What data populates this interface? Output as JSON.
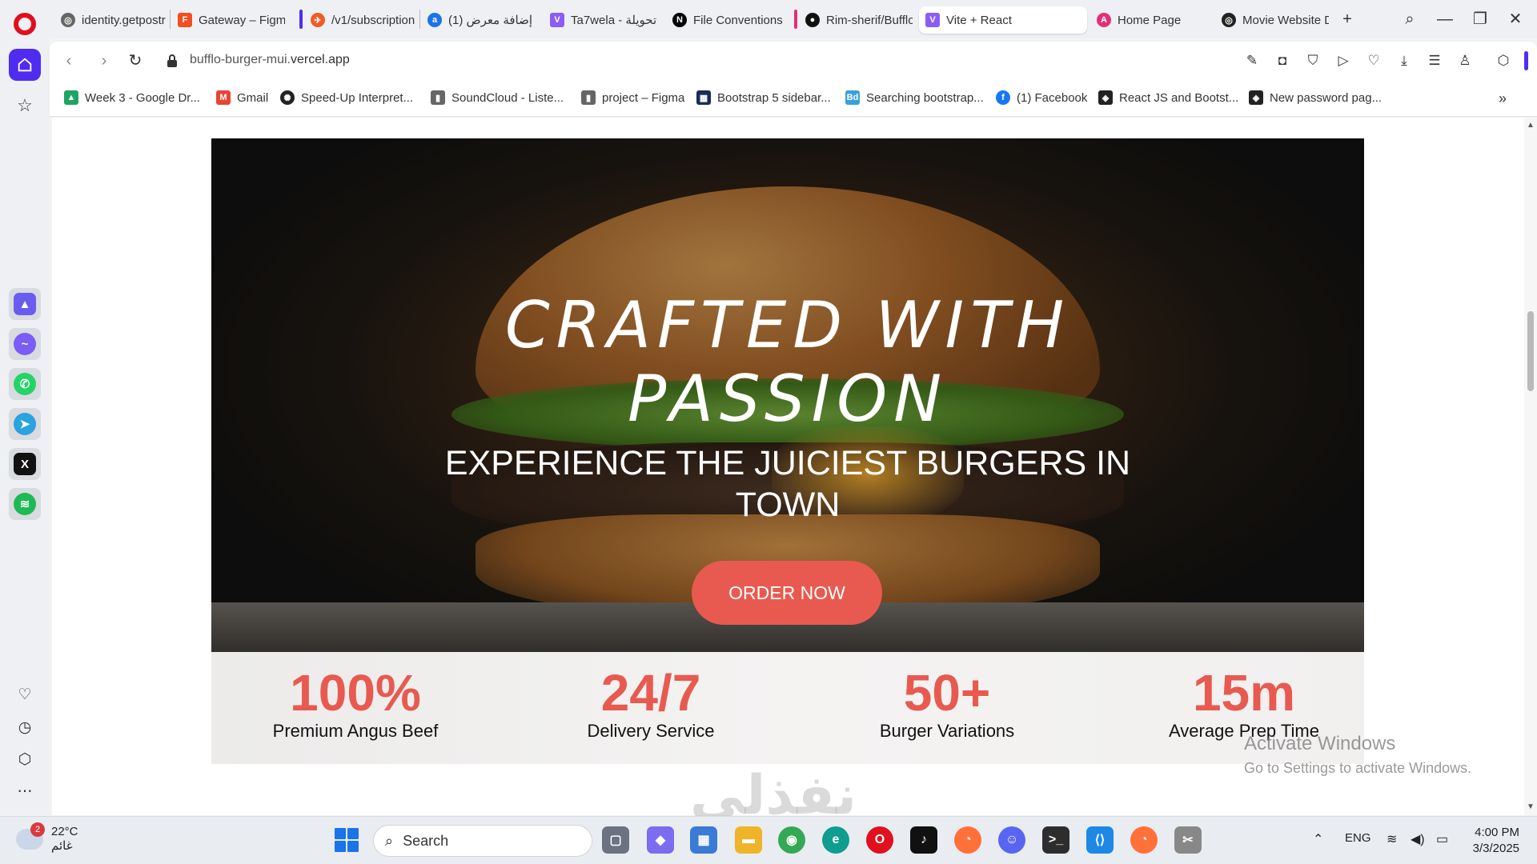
{
  "browser": {
    "tabs": [
      {
        "label": "identity.getpostr",
        "icon": "globe-icon",
        "color": "#555555"
      },
      {
        "label": "Gateway – Figma",
        "icon": "figma-icon",
        "color": "#f24e1e"
      },
      {
        "label": "/v1/subscription",
        "icon": "postman-icon",
        "color": "#ef5b25"
      },
      {
        "label": "(1) إضافة معرض",
        "icon": "site-icon",
        "color": "#1a73e8"
      },
      {
        "label": "Ta7wela - تحويلة",
        "icon": "vite-icon",
        "color": "#8b5cf6"
      },
      {
        "label": "File Conventions",
        "icon": "nextjs-icon",
        "color": "#000000"
      },
      {
        "label": "Rim-sherif/Bufflo",
        "icon": "github-icon",
        "color": "#111111"
      },
      {
        "label": "Vite + React",
        "icon": "vite-icon",
        "color": "#8b5cf6"
      },
      {
        "label": "Home Page",
        "icon": "site-icon",
        "color": "#e0307a"
      },
      {
        "label": "Movie Website D",
        "icon": "site-icon",
        "color": "#222222"
      }
    ],
    "url_host": "bufflo-burger-mui.",
    "url_domain": "vercel.app",
    "bookmarks": [
      {
        "label": "Week 3 - Google Dr...",
        "icon": "drive-icon",
        "color": "#1fa463"
      },
      {
        "label": "Gmail",
        "icon": "gmail-icon",
        "color": "#ea4335"
      },
      {
        "label": "Speed-Up Interpret...",
        "icon": "openai-icon",
        "color": "#222222"
      },
      {
        "label": "SoundCloud - Liste...",
        "icon": "file-icon",
        "color": "#555555"
      },
      {
        "label": "project – Figma",
        "icon": "file-icon",
        "color": "#555555"
      },
      {
        "label": "Bootstrap 5 sidebar...",
        "icon": "site-icon",
        "color": "#1a2a5a"
      },
      {
        "label": "Searching bootstrap...",
        "icon": "bd-icon",
        "color": "#3aa0d8"
      },
      {
        "label": "(1) Facebook",
        "icon": "facebook-icon",
        "color": "#1877f2"
      },
      {
        "label": "React JS and Bootst...",
        "icon": "codepen-icon",
        "color": "#222222"
      },
      {
        "label": "New password pag...",
        "icon": "codepen-icon",
        "color": "#222222"
      }
    ]
  },
  "hero": {
    "title_line1": "CRAFTED WITH",
    "title_line2": "PASSION",
    "subtitle": "EXPERIENCE THE JUICIEST BURGERS IN TOWN",
    "cta": "ORDER NOW"
  },
  "stats": [
    {
      "value": "100%",
      "label": "Premium Angus Beef"
    },
    {
      "value": "24/7",
      "label": "Delivery Service"
    },
    {
      "value": "50+",
      "label": "Burger Variations"
    },
    {
      "value": "15m",
      "label": "Average Prep Time"
    }
  ],
  "activation": {
    "line1": "Activate Windows",
    "line2": "Go to Settings to activate Windows."
  },
  "watermark": "نفذلي",
  "taskbar": {
    "weather_temp": "22°C",
    "weather_desc": "غائم",
    "weather_badge": "2",
    "search_placeholder": "Search",
    "lang": "ENG",
    "time": "4:00 PM",
    "date": "3/3/2025"
  },
  "colors": {
    "accent": "#e85a4f",
    "opera_red": "#e0101e",
    "sidebar_active": "#4f2cf0"
  }
}
